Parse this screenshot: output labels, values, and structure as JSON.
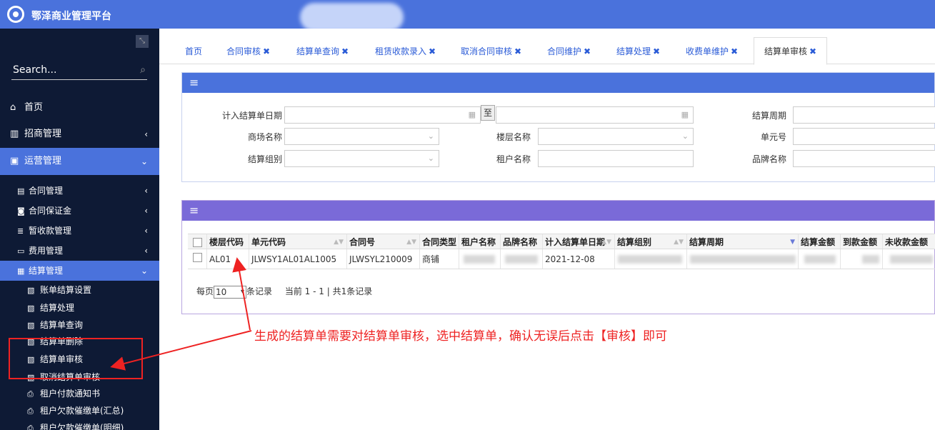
{
  "app": {
    "title": "鄂泽商业管理平台"
  },
  "sidebar": {
    "search_placeholder": "Search...",
    "items": [
      {
        "label": "首页"
      },
      {
        "label": "招商管理"
      },
      {
        "label": "运营管理"
      }
    ],
    "sub_items": [
      {
        "label": "合同管理"
      },
      {
        "label": "合同保证金"
      },
      {
        "label": "暂收款管理"
      },
      {
        "label": "费用管理"
      },
      {
        "label": "结算管理"
      }
    ],
    "leaves": [
      {
        "label": "账单结算设置"
      },
      {
        "label": "结算处理"
      },
      {
        "label": "结算单查询"
      },
      {
        "label": "结算单删除"
      },
      {
        "label": "结算单审核"
      },
      {
        "label": "取消结算单审核"
      },
      {
        "label": "租户付款通知书"
      },
      {
        "label": "租户欠款催缴单(汇总)"
      },
      {
        "label": "租户欠款催缴单(明细)"
      }
    ]
  },
  "tabs": [
    {
      "label": "首页"
    },
    {
      "label": "合同审核"
    },
    {
      "label": "结算单查询"
    },
    {
      "label": "租赁收款录入"
    },
    {
      "label": "取消合同审核"
    },
    {
      "label": "合同维护"
    },
    {
      "label": "结算处理"
    },
    {
      "label": "收费单维护"
    },
    {
      "label": "结算单审核"
    }
  ],
  "filters": {
    "date_label": "计入结算单日期",
    "to_label": "至",
    "period_label": "结算周期",
    "mall_label": "商场名称",
    "floor_label": "楼层名称",
    "unit_label": "单元号",
    "group_label": "结算组别",
    "tenant_label": "租户名称",
    "brand_label": "品牌名称"
  },
  "grid": {
    "columns": [
      "楼层代码",
      "单元代码",
      "合同号",
      "合同类型",
      "租户名称",
      "品牌名称",
      "计入结算单日期",
      "结算组别",
      "结算周期",
      "结算金额",
      "到款金额",
      "未收款金额"
    ],
    "rows": [
      {
        "floor_code": "AL01",
        "unit_code": "JLWSY1AL01AL1005",
        "contract_no": "JLWSYL210009",
        "contract_type": "商铺",
        "date": "2021-12-08"
      }
    ]
  },
  "pager": {
    "prefix": "每页",
    "page_size": "10",
    "suffix": "条记录",
    "status": "当前 1 - 1 | 共1条记录"
  },
  "annotation": {
    "text": "生成的结算单需要对结算单审核，选中结算单，确认无误后点击【审核】即可",
    "color": "#e22222"
  }
}
